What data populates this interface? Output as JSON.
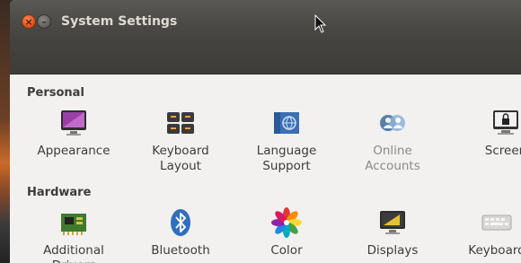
{
  "window": {
    "title": "System Settings",
    "close_symbol": "×",
    "minimize_symbol": "–"
  },
  "sections": [
    {
      "title": "Personal",
      "items": [
        {
          "label": "Appearance",
          "icon": "appearance-icon"
        },
        {
          "label": "Keyboard\nLayout",
          "icon": "keyboard-layout-icon"
        },
        {
          "label": "Language\nSupport",
          "icon": "language-support-icon"
        },
        {
          "label": "Online\nAccounts",
          "icon": "online-accounts-icon"
        },
        {
          "label": "Screen",
          "icon": "screen-lock-icon"
        }
      ]
    },
    {
      "title": "Hardware",
      "items": [
        {
          "label": "Additional\nDrivers",
          "icon": "additional-drivers-icon"
        },
        {
          "label": "Bluetooth",
          "icon": "bluetooth-icon"
        },
        {
          "label": "Color",
          "icon": "color-icon"
        },
        {
          "label": "Displays",
          "icon": "displays-icon"
        },
        {
          "label": "Keyboard",
          "icon": "keyboard-icon"
        }
      ]
    }
  ],
  "colors": {
    "close_button": "#e2541c",
    "titlebar": "#4b4a46",
    "content_bg": "#f2f1f0"
  }
}
